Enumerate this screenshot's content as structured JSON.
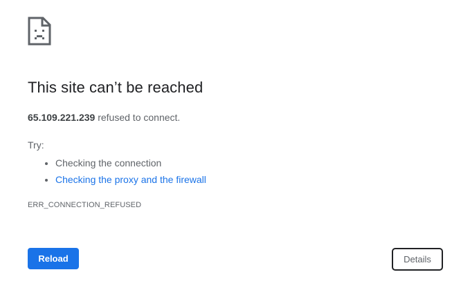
{
  "error": {
    "icon": "sad-page-icon",
    "heading": "This site can’t be reached",
    "host": "65.109.221.239",
    "summary_suffix": " refused to connect.",
    "try_label": "Try:",
    "suggestions": [
      {
        "label": "Checking the connection",
        "is_link": false
      },
      {
        "label": "Checking the proxy and the firewall",
        "is_link": true
      }
    ],
    "code": "ERR_CONNECTION_REFUSED"
  },
  "buttons": {
    "reload_label": "Reload",
    "details_label": "Details"
  },
  "colors": {
    "accent": "#1a73e8",
    "text_primary": "#202124",
    "text_secondary": "#5f6368"
  }
}
